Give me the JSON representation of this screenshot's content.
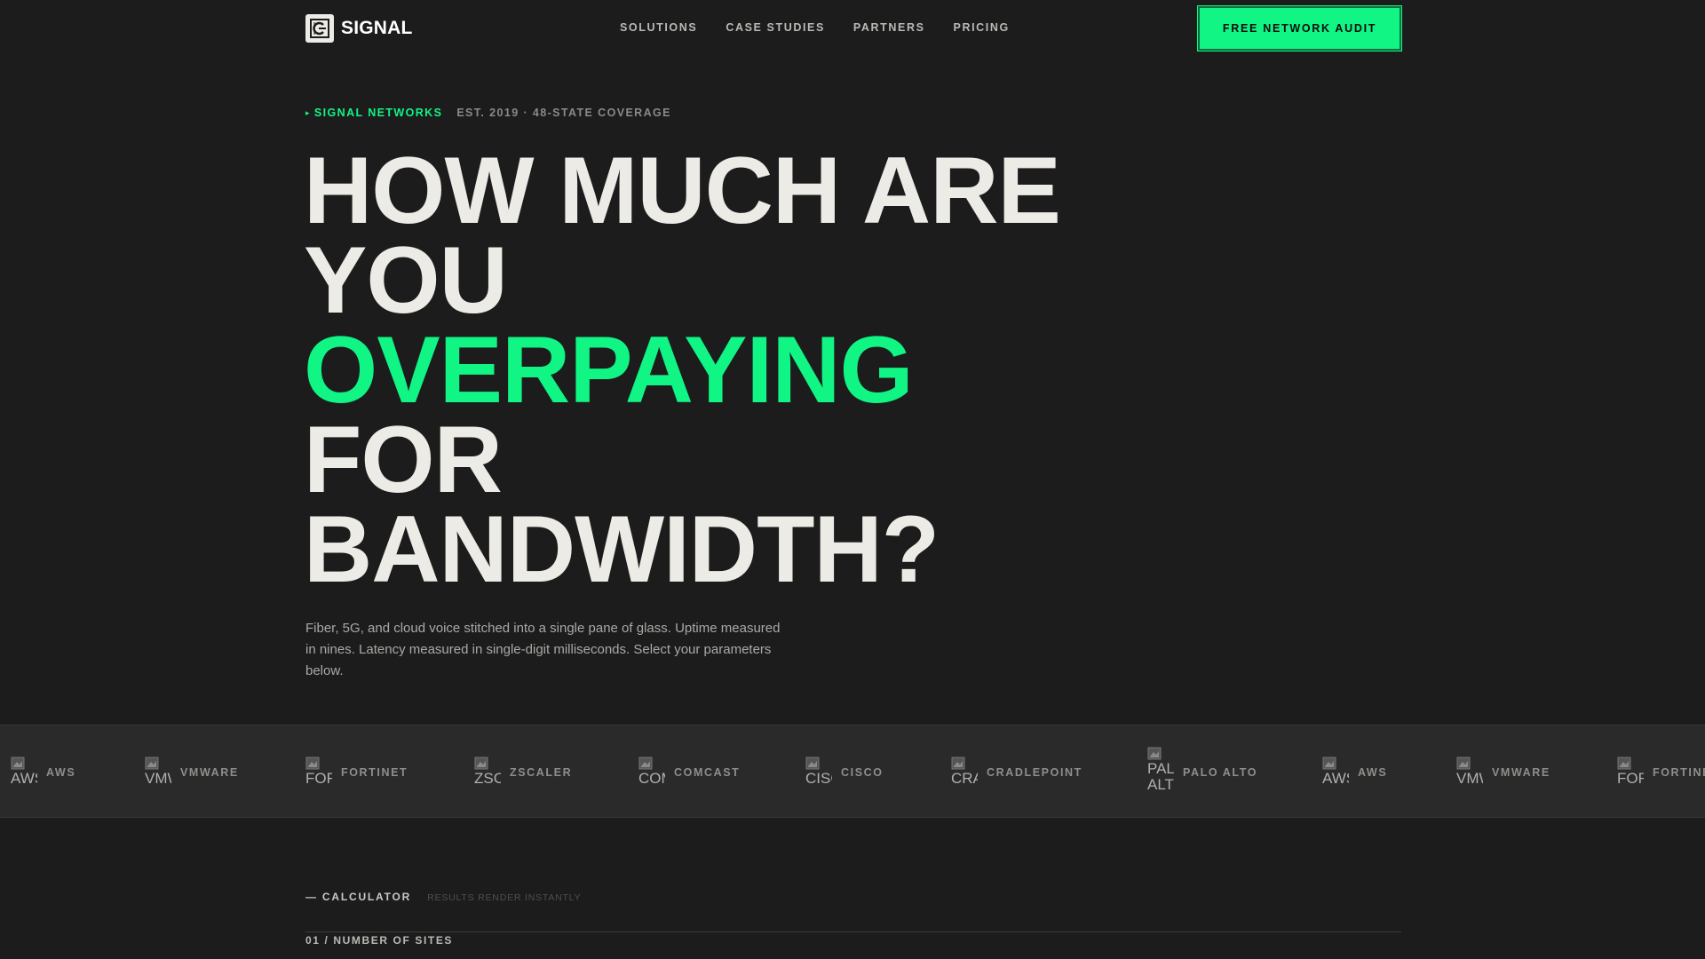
{
  "header": {
    "logo_text": "SIGNAL",
    "logo_icon": "signal-logo-icon",
    "nav": [
      {
        "label": "SOLUTIONS"
      },
      {
        "label": "CASE STUDIES"
      },
      {
        "label": "PARTNERS"
      },
      {
        "label": "PRICING"
      }
    ],
    "cta_label": "FREE NETWORK AUDIT"
  },
  "hero": {
    "eyebrow_brand": "SIGNAL NETWORKS",
    "eyebrow_marker": "▸",
    "eyebrow_meta": "EST. 2019 · 48-STATE COVERAGE",
    "headline_line1": "HOW MUCH ARE",
    "headline_line2": "YOU",
    "headline_accent": "OVERPAYING",
    "headline_line4": "FOR",
    "headline_line5": "BANDWIDTH?",
    "lede": "Fiber, 5G, and cloud voice stitched into a single pane of glass. Uptime measured in nines. Latency measured in single-digit milliseconds. Select your parameters below."
  },
  "partners": [
    {
      "name": "AWS",
      "alt": "AWS"
    },
    {
      "name": "VMWARE",
      "alt": "VMWARE"
    },
    {
      "name": "FORTINET",
      "alt": "FORTINET"
    },
    {
      "name": "ZSCALER",
      "alt": "ZSCALER"
    },
    {
      "name": "COMCAST",
      "alt": "COMCAST"
    },
    {
      "name": "CISCO",
      "alt": "CISCO"
    },
    {
      "name": "CRADLEPOINT",
      "alt": "CRADLEPOINT"
    },
    {
      "name": "PALO ALTO",
      "alt": "PALO ALTO"
    },
    {
      "name": "AWS",
      "alt": "AWS"
    },
    {
      "name": "VMWARE",
      "alt": "VMWARE"
    },
    {
      "name": "FORTINET",
      "alt": "FORTINET"
    }
  ],
  "calculator": {
    "label": "— CALCULATOR",
    "note": "RESULTS RENDER INSTANTLY",
    "step1": "01 / NUMBER OF SITES"
  },
  "colors": {
    "background": "#1c1c1d",
    "accent": "#10f584",
    "text": "#ecebe6",
    "strip": "#2a2a2b"
  }
}
